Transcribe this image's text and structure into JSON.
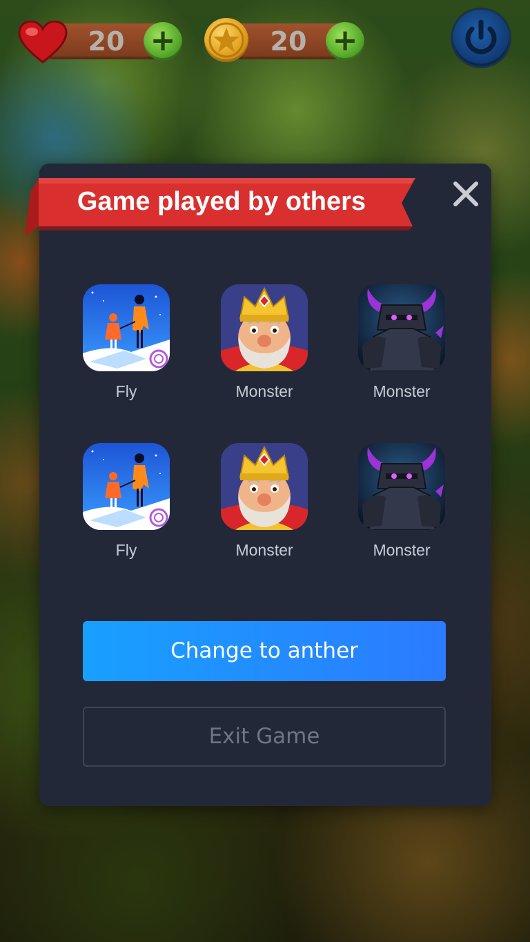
{
  "hud": {
    "hearts": "20",
    "coins": "20"
  },
  "dialog": {
    "title": "Game played by others",
    "games": [
      {
        "label": "Fly",
        "icon": "fly-game-icon"
      },
      {
        "label": "Monster",
        "icon": "king-game-icon"
      },
      {
        "label": "Monster",
        "icon": "pekka-game-icon"
      },
      {
        "label": "Fly",
        "icon": "fly-game-icon"
      },
      {
        "label": "Monster",
        "icon": "king-game-icon"
      },
      {
        "label": "Monster",
        "icon": "pekka-game-icon"
      }
    ],
    "primary_button": "Change to anther",
    "secondary_button": "Exit Game"
  },
  "colors": {
    "dialog_bg": "#232839",
    "ribbon": "#d9302f",
    "primary_start": "#18a0ff",
    "primary_end": "#2b7bff"
  }
}
